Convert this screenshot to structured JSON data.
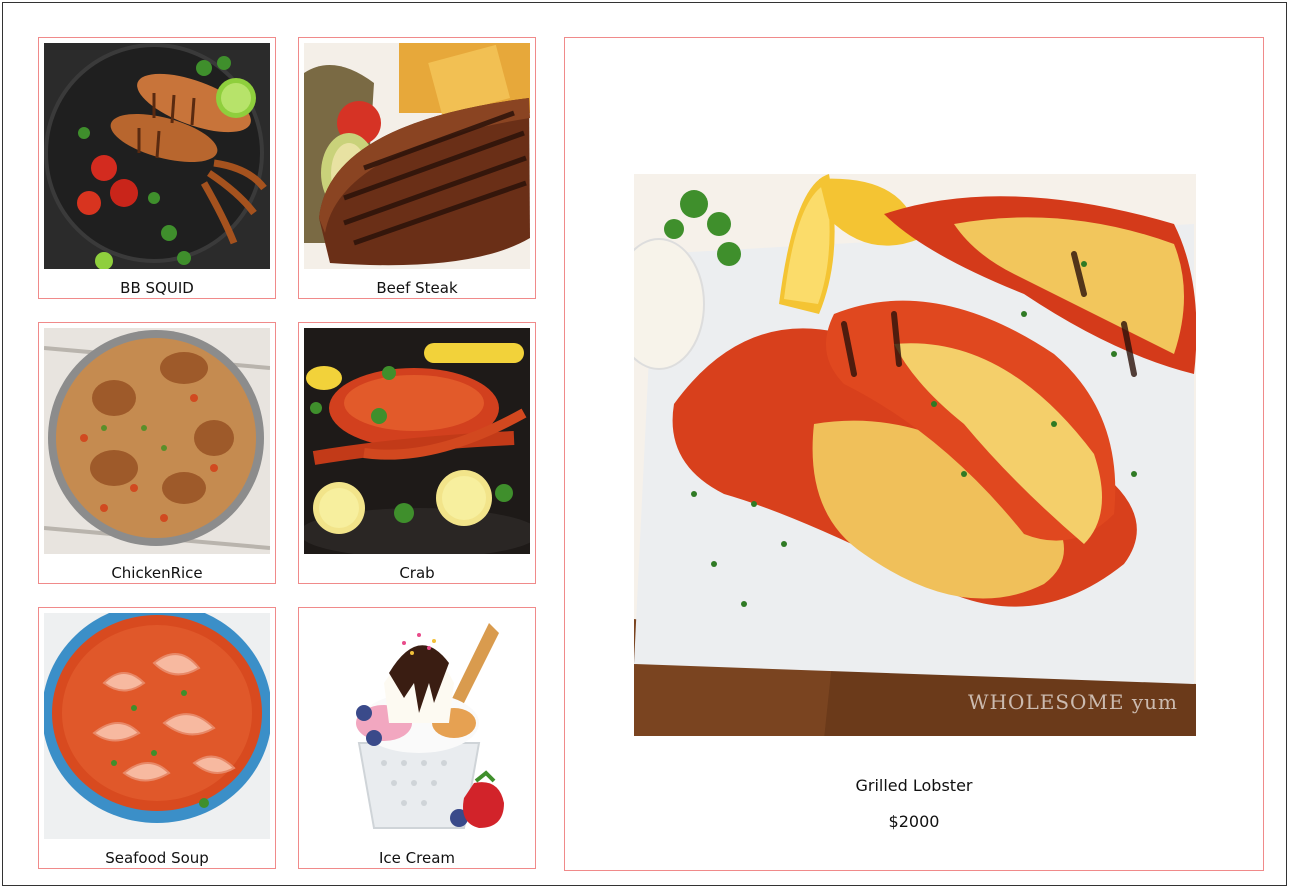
{
  "menu": {
    "items": [
      {
        "label": "BB SQUID",
        "icon": "squid-dish-image"
      },
      {
        "label": "Beef Steak",
        "icon": "steak-dish-image"
      },
      {
        "label": "ChickenRice",
        "icon": "chicken-rice-image"
      },
      {
        "label": "Crab",
        "icon": "crab-dish-image"
      },
      {
        "label": "Seafood Soup",
        "icon": "seafood-soup-image"
      },
      {
        "label": "Ice Cream",
        "icon": "ice-cream-image"
      }
    ]
  },
  "detail": {
    "name": "Grilled Lobster",
    "price": "$2000",
    "watermark": "WHOLESOME yum"
  },
  "colors": {
    "card_border": "#f08a8a",
    "frame_border": "#333333",
    "background": "#ffffff"
  }
}
